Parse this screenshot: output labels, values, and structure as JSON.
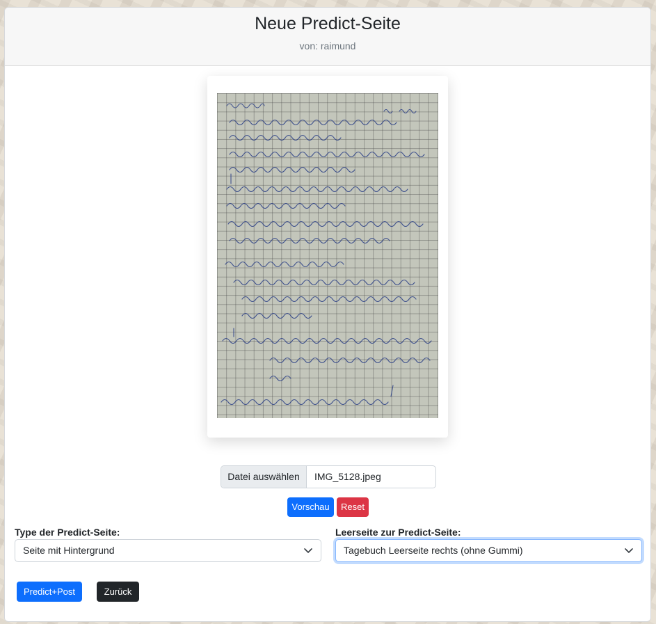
{
  "header": {
    "title": "Neue Predict-Seite",
    "subtitle": "von: raimund"
  },
  "preview": {
    "date": "Do 27.4.23",
    "heading": "OBERSTAUFEN",
    "lines": [
      "Wetter recht gut durchlaufen, war schnell kurz vor Mittag",
      "und folgend Dorset recht ausgeschlafen.",
      "Heute ist meine Sonne (Sonne) kaum, bleib ist heim, ich halte",
      "mich sorgsam mit ein Weitblick auch.",
      "Frühstück: Müsli, Kaugummi und Obst getrennt.",
      "Nachher sonnigen Tag ohne Regen.",
      "Wir machen eine Wanderung zum „Grünten an Stiel“",
      "und mich erwartet: Eine schöne Aussicht!",
      "Nachmittags: nach Weitnau + Temme",
      "Der Rückweg ist zu eher mühsam mit breitem Weg.",
      "Dann geht schnell bis der Bereich „Panorama“",
      "nicht mehr weit.",
      "Abendessen: Salat + Kartoffeln + Spinat/Rote Beete – Haube",
      "mit Kräutersoße + Vollkorn, und noch Beeren",
      "gereicht.",
      "Es wird langsam, wir sind alle müde!"
    ]
  },
  "file_input": {
    "button_label": "Datei auswählen",
    "file_name": "IMG_5128.jpeg"
  },
  "buttons": {
    "preview": "Vorschau",
    "reset": "Reset",
    "predict": "Predict+Post",
    "back": "Zurück"
  },
  "type_select": {
    "label": "Type der Predict-Seite:",
    "value": "Seite mit Hintergrund"
  },
  "blank_select": {
    "label": "Leerseite zur Predict-Seite:",
    "value": "Tagebuch Leerseite rechts (ohne Gummi)"
  },
  "colors": {
    "primary": "#0d6efd",
    "danger": "#dc3545",
    "dark": "#212529",
    "ink": "#2b3f86"
  }
}
